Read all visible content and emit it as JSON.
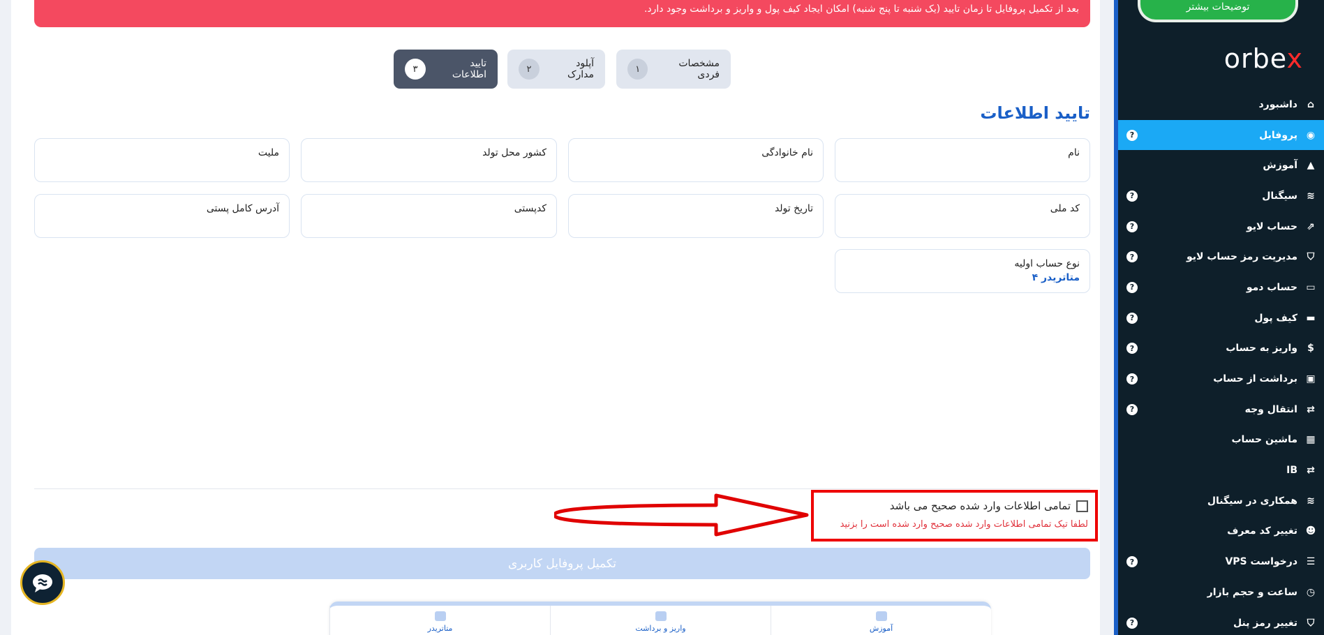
{
  "alert": {
    "text": "بعد از تکمیل پروفایل تا زمان تایید (یک شنبه تا پنج شنبه) امکان ایجاد کیف پول و واریز و برداشت وجود دارد."
  },
  "steps": [
    {
      "num": "۱",
      "label": "مشخصات فردی",
      "active": false
    },
    {
      "num": "۲",
      "label": "آپلود مدارک",
      "active": false
    },
    {
      "num": "۳",
      "label": "تایید اطلاعات",
      "active": true
    }
  ],
  "section_title": "تایید اطلاعات",
  "fields": {
    "first_name": {
      "label": "نام",
      "value": ""
    },
    "last_name": {
      "label": "نام خانوادگی",
      "value": ""
    },
    "birth_country": {
      "label": "کشور محل تولد",
      "value": ""
    },
    "nationality": {
      "label": "ملیت",
      "value": ""
    },
    "national_code": {
      "label": "کد ملی",
      "value": ""
    },
    "birth_date": {
      "label": "تاریخ تولد",
      "value": ""
    },
    "postal_code": {
      "label": "کدپستی",
      "value": ""
    },
    "address": {
      "label": "آدرس کامل پستی",
      "value": ""
    },
    "account_type": {
      "label": "نوع حساب اولیه",
      "value": "متاتریدر ۴"
    }
  },
  "confirm": {
    "label": "تمامی اطلاعات وارد شده صحیح می باشد",
    "error": "لطفا تیک تمامی اطلاعات وارد شده صحیح وارد شده است را بزنید",
    "checked": false
  },
  "submit_label": "تکمیل پروفایل کاربری",
  "bottom_nav": [
    {
      "label": "آموزش",
      "icon": "presentation-icon"
    },
    {
      "label": "واریز و برداشت",
      "icon": "wallet-icon"
    },
    {
      "label": "متاتریدر",
      "icon": "chart-icon"
    }
  ],
  "sidebar": {
    "more_button": "توضیحات بیشتر",
    "logo_main": "orbe",
    "logo_x": "x",
    "items": [
      {
        "label": "داشبورد",
        "icon": "⌂",
        "help": false,
        "active": false
      },
      {
        "label": "پروفایل",
        "icon": "◉",
        "help": true,
        "active": true
      },
      {
        "label": "آموزش",
        "icon": "▲",
        "help": false,
        "active": false
      },
      {
        "label": "سیگنال",
        "icon": "≋",
        "help": true,
        "active": false
      },
      {
        "label": "حساب لایو",
        "icon": "⇗",
        "help": true,
        "active": false
      },
      {
        "label": "مدیریت رمز حساب لایو",
        "icon": "⛉",
        "help": true,
        "active": false
      },
      {
        "label": "حساب دمو",
        "icon": "▭",
        "help": true,
        "active": false
      },
      {
        "label": "کیف پول",
        "icon": "▬",
        "help": true,
        "active": false
      },
      {
        "label": "واریز به حساب",
        "icon": "$",
        "help": true,
        "active": false
      },
      {
        "label": "برداشت از حساب",
        "icon": "▣",
        "help": true,
        "active": false
      },
      {
        "label": "انتقال وجه",
        "icon": "⇄",
        "help": true,
        "active": false
      },
      {
        "label": "ماشین حساب",
        "icon": "▦",
        "help": false,
        "active": false
      },
      {
        "label": "IB",
        "icon": "⇄",
        "help": false,
        "active": false
      },
      {
        "label": "همکاری در سیگنال",
        "icon": "≋",
        "help": false,
        "active": false
      },
      {
        "label": "تغییر کد معرف",
        "icon": "☻",
        "help": false,
        "active": false
      },
      {
        "label": "درخواست VPS",
        "icon": "☰",
        "help": true,
        "active": false
      },
      {
        "label": "ساعت و حجم بازار",
        "icon": "◷",
        "help": false,
        "active": false
      },
      {
        "label": "تغییر رمز پنل",
        "icon": "⛉",
        "help": true,
        "active": false
      }
    ]
  },
  "colors": {
    "alert": "#f4495f",
    "accent": "#1a5fc7",
    "sidebar_bg": "#0e1f2a",
    "sidebar_active": "#1ba9f5",
    "more_button": "#27b24a",
    "annotation_red": "#e00000"
  }
}
